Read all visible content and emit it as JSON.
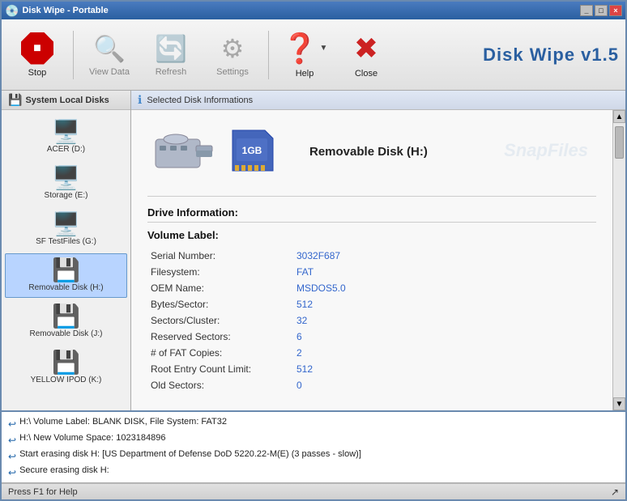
{
  "titlebar": {
    "title": "Disk Wipe - Portable",
    "buttons": [
      "_",
      "□",
      "×"
    ]
  },
  "toolbar": {
    "app_title": "Disk Wipe v1.5",
    "buttons": [
      {
        "id": "stop",
        "label": "Stop",
        "icon": "stop",
        "enabled": true
      },
      {
        "id": "viewdata",
        "label": "View Data",
        "icon": "viewdata",
        "enabled": false
      },
      {
        "id": "refresh",
        "label": "Refresh",
        "icon": "refresh",
        "enabled": false
      },
      {
        "id": "settings",
        "label": "Settings",
        "icon": "settings",
        "enabled": false
      },
      {
        "id": "help",
        "label": "Help",
        "icon": "help",
        "enabled": true,
        "has_dropdown": true
      },
      {
        "id": "close",
        "label": "Close",
        "icon": "close",
        "enabled": true
      }
    ]
  },
  "left_panel": {
    "header": "System Local Disks",
    "header_icon": "💾",
    "disks": [
      {
        "label": "ACER (D:)",
        "icon": "💽",
        "selected": false
      },
      {
        "label": "Storage (E:)",
        "icon": "💽",
        "selected": false
      },
      {
        "label": "SF TestFiles (G:)",
        "icon": "💽",
        "selected": false
      },
      {
        "label": "Removable Disk (H:)",
        "icon": "💾",
        "selected": true
      },
      {
        "label": "Removable Disk (J:)",
        "icon": "💾",
        "selected": false
      },
      {
        "label": "YELLOW IPOD (K:)",
        "icon": "💾",
        "selected": false
      }
    ]
  },
  "right_panel": {
    "header": "Selected Disk Informations",
    "header_icon": "ℹ",
    "disk_title": "Removable Disk  (H:)",
    "drive_info_label": "Drive Information:",
    "volume_label_title": "Volume Label:",
    "fields": [
      {
        "name": "Serial Number:",
        "value": "3032F687"
      },
      {
        "name": "Filesystem:",
        "value": "FAT"
      },
      {
        "name": "OEM Name:",
        "value": "MSDOS5.0"
      },
      {
        "name": "Bytes/Sector:",
        "value": "512"
      },
      {
        "name": "Sectors/Cluster:",
        "value": "32"
      },
      {
        "name": "Reserved Sectors:",
        "value": "6"
      },
      {
        "name": "# of FAT Copies:",
        "value": "2"
      },
      {
        "name": "Root Entry Count Limit:",
        "value": "512"
      },
      {
        "name": "Old Sectors:",
        "value": "0"
      }
    ],
    "watermark": "SnapFiles"
  },
  "status_log": {
    "entries": [
      "H:\\ Volume Label: BLANK DISK, File System: FAT32",
      "H:\\ New Volume Space: 1023184896",
      "Start erasing disk H: [US Department of Defense DoD 5220.22-M(E) (3 passes - slow)]",
      "Secure erasing disk H:"
    ]
  },
  "statusbar": {
    "help_text": "Press F1 for Help",
    "corner_icon": "↗"
  }
}
